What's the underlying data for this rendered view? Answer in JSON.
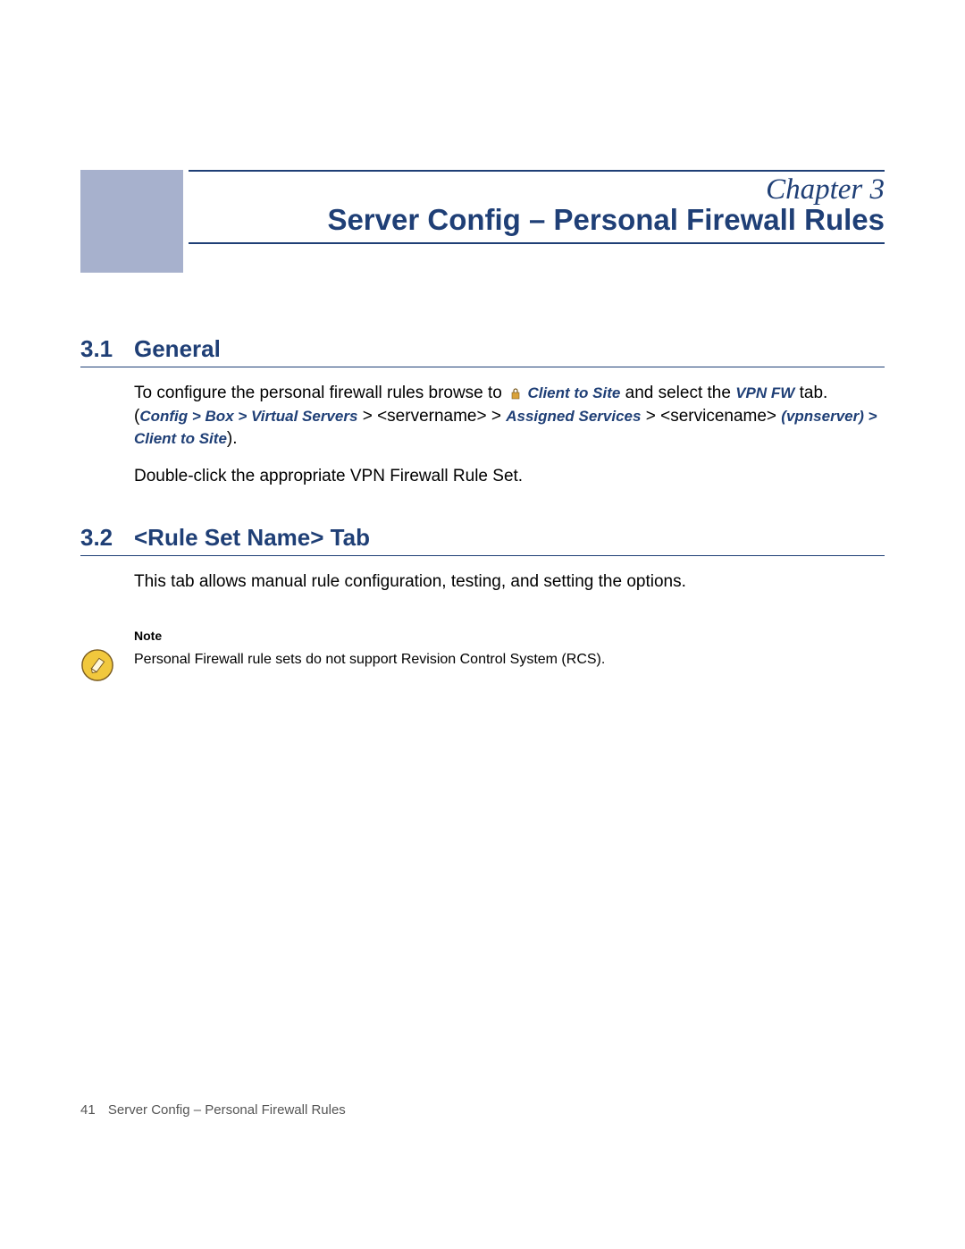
{
  "chapter": {
    "label": "Chapter 3",
    "title": "Server Config – Personal Firewall Rules"
  },
  "sections": {
    "s1": {
      "num": "3.1",
      "title": "General",
      "para1_a": "To configure the personal firewall rules browse to ",
      "para1_link1": "Client to Site",
      "para1_b": " and select the ",
      "para1_link2": "VPN FW",
      "para1_c": " tab. (",
      "bc1": "Config",
      "gt": " > ",
      "bc2": "Box",
      "bc3": "Virtual Servers",
      "bc_p1": " > <servername> > ",
      "bc4": "Assigned Services",
      "bc_p2": " > <servicename> ",
      "bc5": "(vpnserver)",
      "bc6": "Client to Site",
      "para1_d": ").",
      "para2": "Double-click the appropriate VPN Firewall Rule Set."
    },
    "s2": {
      "num": "3.2",
      "title": "<Rule Set Name> Tab",
      "para1": "This tab allows manual rule configuration, testing, and setting the options."
    }
  },
  "note": {
    "label": "Note",
    "text": "Personal Firewall rule sets do not support Revision Control System (RCS)."
  },
  "footer": {
    "page": "41",
    "title": "Server Config – Personal Firewall Rules"
  }
}
